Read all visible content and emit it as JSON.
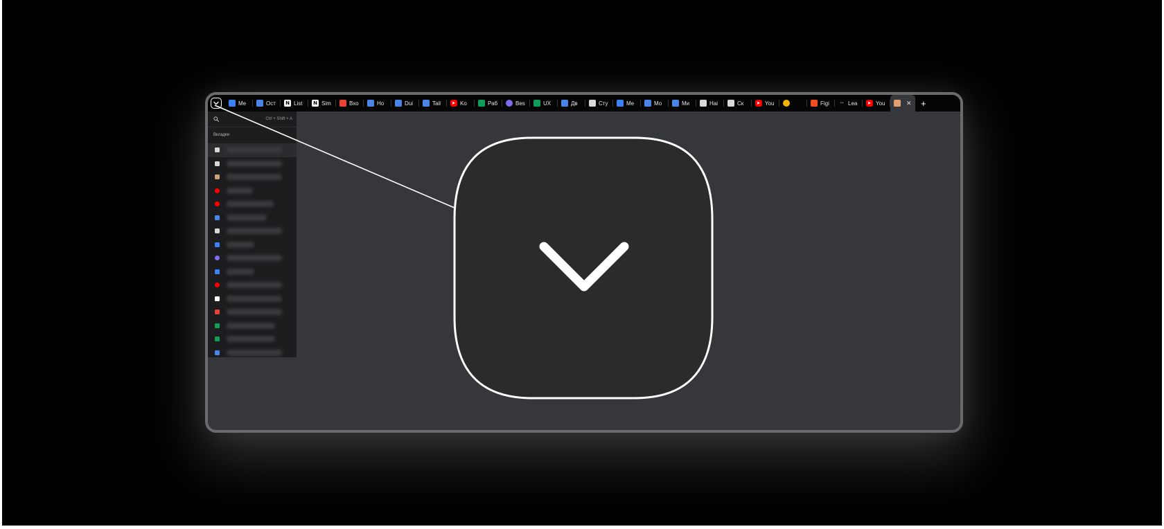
{
  "tab_bar": {
    "tabs": [
      {
        "title": "Me",
        "icon": "chat-icon",
        "color": "#3b82f6"
      },
      {
        "title": "Ост",
        "icon": "docs-icon",
        "color": "#4a86e8"
      },
      {
        "title": "List",
        "icon": "notion-icon",
        "color": "#ffffff"
      },
      {
        "title": "Sim",
        "icon": "notion-icon",
        "color": "#ffffff"
      },
      {
        "title": "Вхо",
        "icon": "gmail-icon",
        "color": "#ea4335"
      },
      {
        "title": "Ho",
        "icon": "docs-icon",
        "color": "#4a86e8"
      },
      {
        "title": "Dui",
        "icon": "docs-icon",
        "color": "#4a86e8"
      },
      {
        "title": "Tail",
        "icon": "docs-icon",
        "color": "#4a86e8"
      },
      {
        "title": "Ko",
        "icon": "youtube-icon",
        "color": "#ff0000"
      },
      {
        "title": "Раб",
        "icon": "sheets-icon",
        "color": "#0f9d58"
      },
      {
        "title": "Bes",
        "icon": "compass-icon",
        "color": "#7c6cf0"
      },
      {
        "title": "UX",
        "icon": "sheets-icon",
        "color": "#0f9d58"
      },
      {
        "title": "Дв",
        "icon": "docs-icon",
        "color": "#4a86e8"
      },
      {
        "title": "Сту",
        "icon": "page-icon",
        "color": "#d9d9d9"
      },
      {
        "title": "Me",
        "icon": "chat-icon",
        "color": "#3b82f6"
      },
      {
        "title": "Мо",
        "icon": "docs-icon",
        "color": "#4a86e8"
      },
      {
        "title": "Ми",
        "icon": "docs-icon",
        "color": "#4a86e8"
      },
      {
        "title": "Hai",
        "icon": "page-icon",
        "color": "#d9d9d9"
      },
      {
        "title": "Ск",
        "icon": "page-icon",
        "color": "#d9d9d9"
      },
      {
        "title": "You",
        "icon": "youtube-icon",
        "color": "#ff0000"
      },
      {
        "title": "",
        "icon": "chrome-icon",
        "color": "#f4b400"
      },
      {
        "title": "Figi",
        "icon": "figma-icon",
        "color": "#f24e1e"
      },
      {
        "title": "Lea",
        "icon": "dots-icon",
        "color": "#888888"
      },
      {
        "title": "You",
        "icon": "youtube-icon",
        "color": "#ff0000"
      }
    ],
    "active_tab": {
      "icon": "burger-icon",
      "color": "#e0a070"
    },
    "new_tab_label": "+"
  },
  "tab_search_panel": {
    "shortcut": "Ctrl + Shift + A",
    "section_title": "Вкладки",
    "items": [
      {
        "icon": "page-icon",
        "color": "#d8d8d8"
      },
      {
        "icon": "page-icon",
        "color": "#d8d8d8"
      },
      {
        "icon": "burger-icon",
        "color": "#c9a27a"
      },
      {
        "icon": "youtube-icon",
        "color": "#ff0000"
      },
      {
        "icon": "youtube-icon",
        "color": "#ff0000"
      },
      {
        "icon": "docs-icon",
        "color": "#4a86e8"
      },
      {
        "icon": "page-icon",
        "color": "#d8d8d8"
      },
      {
        "icon": "chat-icon",
        "color": "#3b82f6"
      },
      {
        "icon": "compass-icon",
        "color": "#7c6cf0"
      },
      {
        "icon": "chat-icon",
        "color": "#3b82f6"
      },
      {
        "icon": "youtube-icon",
        "color": "#ff0000"
      },
      {
        "icon": "notion-icon",
        "color": "#ffffff"
      },
      {
        "icon": "gmail-icon",
        "color": "#ea4335"
      },
      {
        "icon": "sheets-icon",
        "color": "#0f9d58"
      },
      {
        "icon": "sheets-icon",
        "color": "#0f9d58"
      },
      {
        "icon": "docs-icon",
        "color": "#4a86e8"
      }
    ]
  },
  "callout": {
    "icon": "chevron-down-icon",
    "outline_color": "#ffffff",
    "fill_color": "#2b2b2b"
  }
}
